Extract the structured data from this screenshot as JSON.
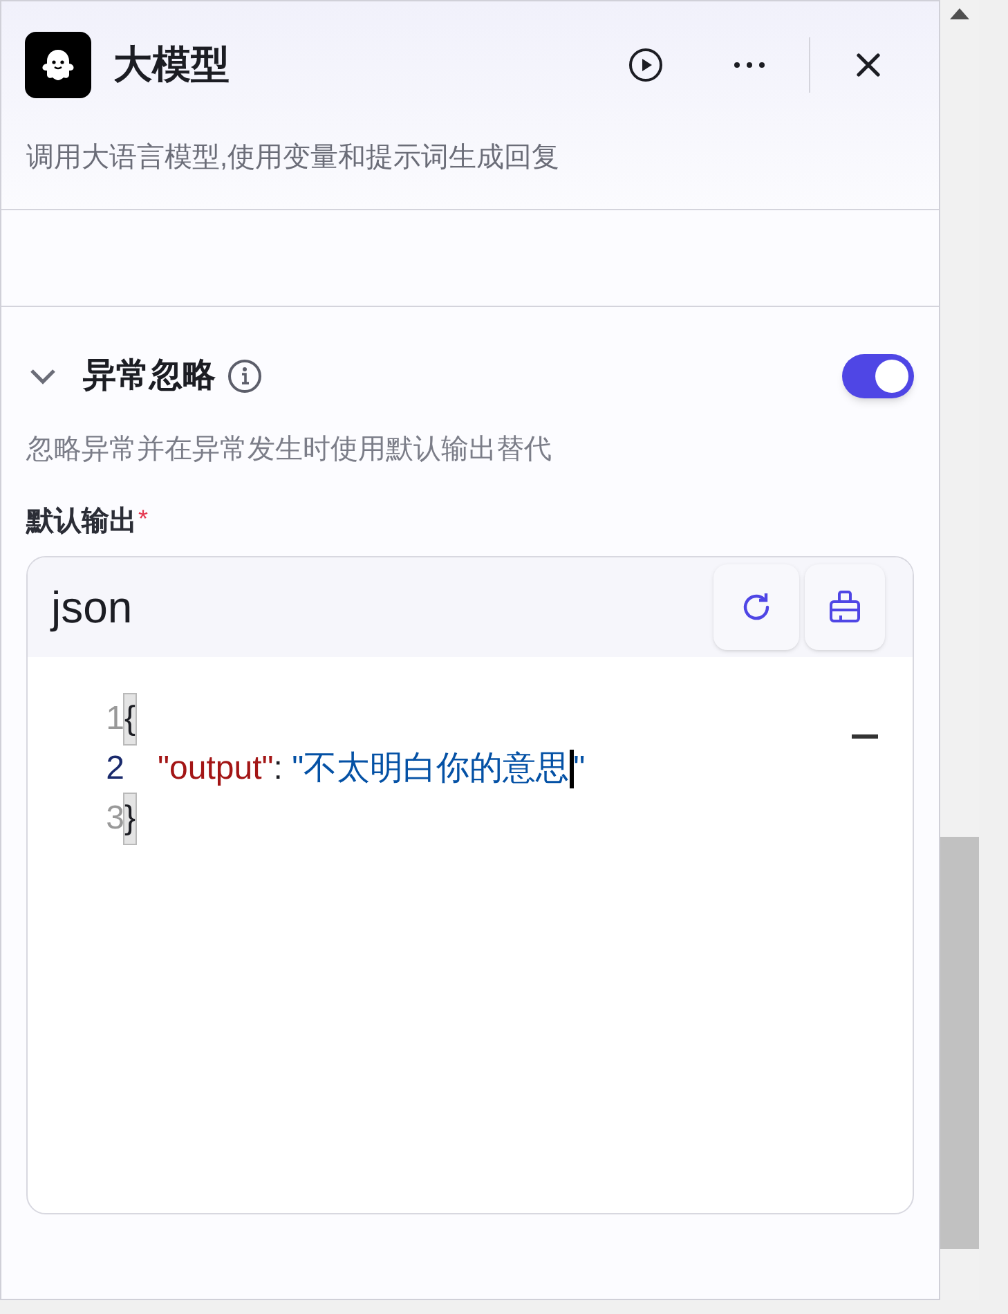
{
  "header": {
    "title": "大模型",
    "description": "调用大语言模型,使用变量和提示词生成回复"
  },
  "section": {
    "title": "异常忽略",
    "expanded": true,
    "toggle_on": true,
    "description": "忽略异常并在异常发生时使用默认输出替代"
  },
  "field": {
    "label": "默认输出",
    "required_mark": "*"
  },
  "editor": {
    "language": "json",
    "lines": [
      {
        "number": "1",
        "active": false,
        "tokens": [
          {
            "kind": "bracket",
            "text": "{",
            "matched": true
          }
        ]
      },
      {
        "number": "2",
        "active": true,
        "tokens": [
          {
            "kind": "key",
            "text": "\"output\""
          },
          {
            "kind": "punct",
            "text": ": "
          },
          {
            "kind": "string",
            "text": "\"不太明白你的意思"
          },
          {
            "kind": "cursor"
          },
          {
            "kind": "string",
            "text": "\""
          }
        ]
      },
      {
        "number": "3",
        "active": false,
        "tokens": [
          {
            "kind": "bracket",
            "text": "}",
            "matched": true
          }
        ]
      }
    ]
  }
}
